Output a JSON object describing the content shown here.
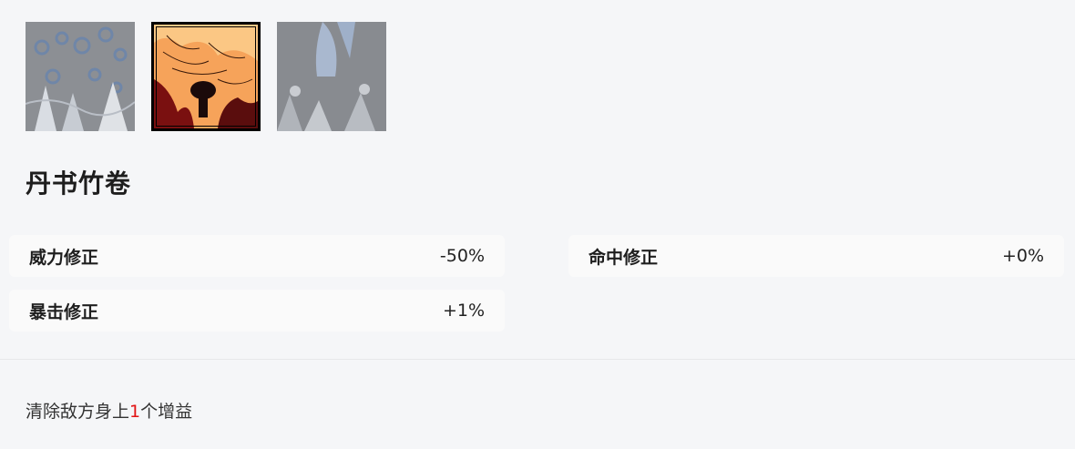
{
  "thumbnails": [
    {
      "name": "thumb-1",
      "selected": false
    },
    {
      "name": "thumb-2",
      "selected": true
    },
    {
      "name": "thumb-3",
      "selected": false
    }
  ],
  "skill": {
    "title": "丹书竹卷"
  },
  "stats": {
    "power": {
      "label": "威力修正",
      "value": "-50%"
    },
    "hit": {
      "label": "命中修正",
      "value": "+0%"
    },
    "crit": {
      "label": "暴击修正",
      "value": "+1%"
    }
  },
  "effect": {
    "prefix": "清除敌方身上",
    "count": "1",
    "suffix": "个增益"
  },
  "colors": {
    "highlight": "#e21414",
    "background": "#f5f6f8",
    "card": "#fafafa"
  }
}
